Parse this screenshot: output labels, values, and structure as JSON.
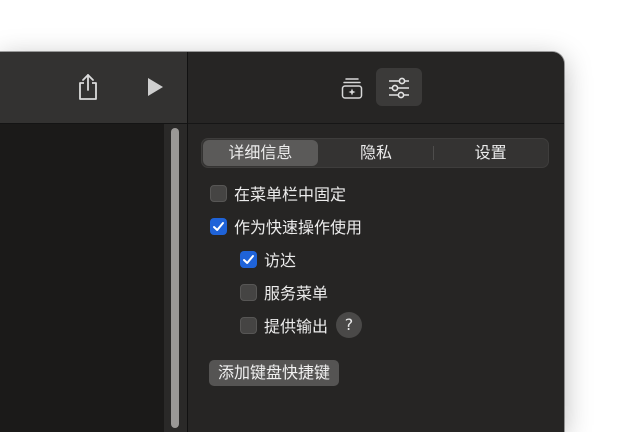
{
  "toolbar": {
    "share_icon": "share-icon",
    "run_icon": "play-icon"
  },
  "inspector": {
    "tabs": [
      {
        "icon": "action-library-icon"
      },
      {
        "icon": "sliders-icon",
        "selected": true
      }
    ],
    "segments": [
      "详细信息",
      "隐私",
      "设置"
    ],
    "selected_segment": "详细信息",
    "options": {
      "pin_menu_bar": {
        "label": "在菜单栏中固定",
        "checked": false
      },
      "quick_action": {
        "label": "作为快速操作使用",
        "checked": true
      },
      "finder": {
        "label": "访达",
        "checked": true
      },
      "services_menu": {
        "label": "服务菜单",
        "checked": false
      },
      "provide_output": {
        "label": "提供输出",
        "checked": false
      }
    },
    "help_label": "?",
    "add_shortcut_label": "添加键盘快捷键"
  },
  "colors": {
    "accent": "#1f63d8",
    "window_bg": "#262524"
  }
}
